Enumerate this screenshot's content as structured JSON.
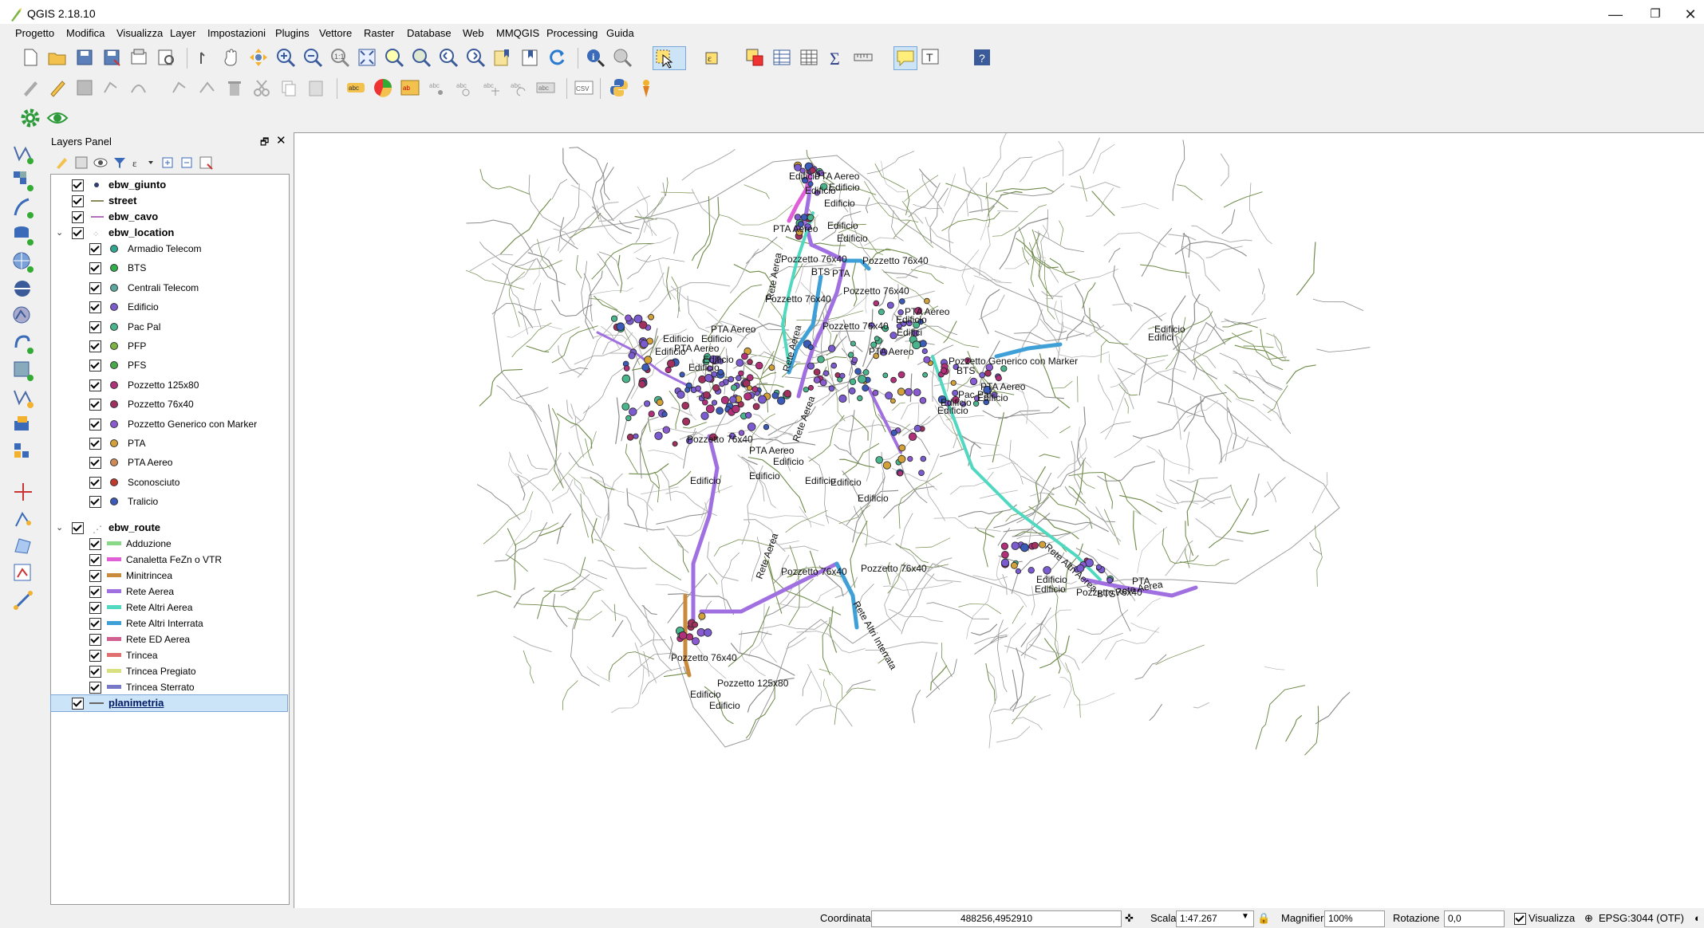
{
  "window": {
    "title": "QGIS 2.18.10"
  },
  "menubar": [
    "Progetto",
    "Modifica",
    "Visualizza",
    "Layer",
    "Impostazioni",
    "Plugins",
    "Vettore",
    "Raster",
    "Database",
    "Web",
    "MMQGIS",
    "Processing",
    "Guida"
  ],
  "layers_panel": {
    "title": "Layers Panel",
    "groups": [
      {
        "label": "ebw_giunto"
      },
      {
        "label": "street"
      },
      {
        "label": "ebw_cavo"
      },
      {
        "label": "ebw_location",
        "children": [
          "Armadio Telecom",
          "BTS",
          "Centrali Telecom",
          "Edificio",
          "Pac Pal",
          "PFP",
          "PFS",
          "Pozzetto 125x80",
          "Pozzetto 76x40",
          "Pozzetto Generico con Marker",
          "PTA",
          "PTA Aereo",
          "Sconosciuto",
          "Tralicio"
        ]
      },
      {
        "label": "ebw_route",
        "children": [
          "Adduzione",
          "Canaletta FeZn o VTR",
          "Minitrincea",
          "Rete Aerea",
          "Rete Altri Aerea",
          "Rete Altri Interrata",
          "Rete ED Aerea",
          "Trincea",
          "Trincea Pregiato",
          "Trincea Sterrato"
        ]
      },
      {
        "label": "planimetria"
      }
    ],
    "location_colors": [
      "#2fa88f",
      "#2fae4a",
      "#5aa8a0",
      "#7b5bd0",
      "#49b58c",
      "#7cb342",
      "#48a848",
      "#b0307a",
      "#a0305e",
      "#8a5bd0",
      "#d3a13a",
      "#cf8a58",
      "#c0392b",
      "#3b5bb8"
    ],
    "route_colors": [
      "#88d888",
      "#e060d8",
      "#c98a3c",
      "#a070e0",
      "#50d8c0",
      "#3fa0d8",
      "#d06090",
      "#e07070",
      "#d8e080",
      "#7878c8"
    ]
  },
  "map": {
    "labels": [
      "Edificio",
      "PTA Aereo",
      "Pozzetto 76x40",
      "BTS",
      "PTA",
      "Pozzetto Generico con Marker",
      "Pozzetto 125x80",
      "Rete Aerea",
      "Rete Altri Aerea",
      "Rete Altri Interrata",
      "Pac Pal",
      "Edifici"
    ]
  },
  "status": {
    "coord_label": "Coordinata",
    "coord_value": "488256,4952910",
    "scale_label": "Scala",
    "scale_value": "1:47.267",
    "magnifier_label": "Magnifier",
    "magnifier_value": "100%",
    "rotation_label": "Rotazione",
    "rotation_value": "0,0",
    "render_label": "Visualizza",
    "crs": "EPSG:3044 (OTF)"
  }
}
